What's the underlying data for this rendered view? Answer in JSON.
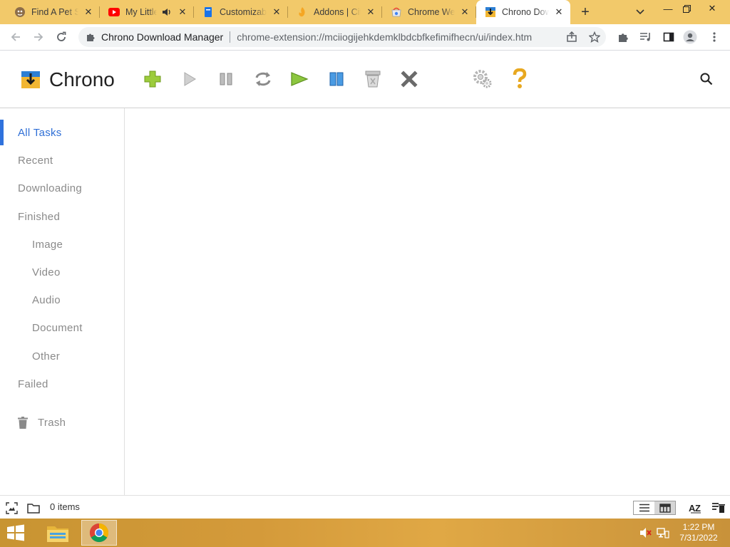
{
  "browser": {
    "tabs": [
      {
        "title": "Find A Pet Su",
        "favicon": "pet-favicon-icon"
      },
      {
        "title": "My Little",
        "favicon": "youtube-favicon-icon",
        "audio": "speaker-icon"
      },
      {
        "title": "Customizabl",
        "favicon": "blue-doc-favicon-icon"
      },
      {
        "title": "Addons | Cit",
        "favicon": "flame-favicon-icon"
      },
      {
        "title": "Chrome Web",
        "favicon": "chrome-store-favicon-icon"
      },
      {
        "title": "Chrono Dow",
        "favicon": "chrono-favicon-icon",
        "active": true
      }
    ],
    "omnibox": {
      "site_name": "Chrono Download Manager",
      "url": "chrome-extension://mciiogijehkdemklbdcbfkefimifhecn/ui/index.htm"
    }
  },
  "app": {
    "title": "Chrono",
    "toolbar": [
      {
        "name": "add-icon",
        "color": "#8bc34a"
      },
      {
        "name": "play-icon",
        "color": "#b0b0b0"
      },
      {
        "name": "pause-icon",
        "color": "#9a9a9a"
      },
      {
        "name": "retry-icon",
        "color": "#9a9a9a"
      },
      {
        "name": "start-all-icon",
        "color": "#7cb82f"
      },
      {
        "name": "pause-all-icon",
        "color": "#3b8fd8"
      },
      {
        "name": "clear-icon",
        "color": "#a0a0a0"
      },
      {
        "name": "delete-icon",
        "color": "#666666"
      },
      {
        "name": "settings-icon",
        "color": "#b0b0b0"
      },
      {
        "name": "help-icon",
        "color": "#f0b429"
      }
    ],
    "accent": "#2f72dd"
  },
  "sidebar": {
    "items": [
      {
        "label": "All Tasks",
        "active": true
      },
      {
        "label": "Recent"
      },
      {
        "label": "Downloading"
      },
      {
        "label": "Finished"
      },
      {
        "label": "Image"
      },
      {
        "label": "Video"
      },
      {
        "label": "Audio"
      },
      {
        "label": "Document"
      },
      {
        "label": "Other"
      },
      {
        "label": "Failed"
      }
    ],
    "trash_label": "Trash"
  },
  "statusbar": {
    "count": "0 items"
  },
  "taskbar": {
    "time": "1:22 PM",
    "date": "7/31/2022"
  }
}
